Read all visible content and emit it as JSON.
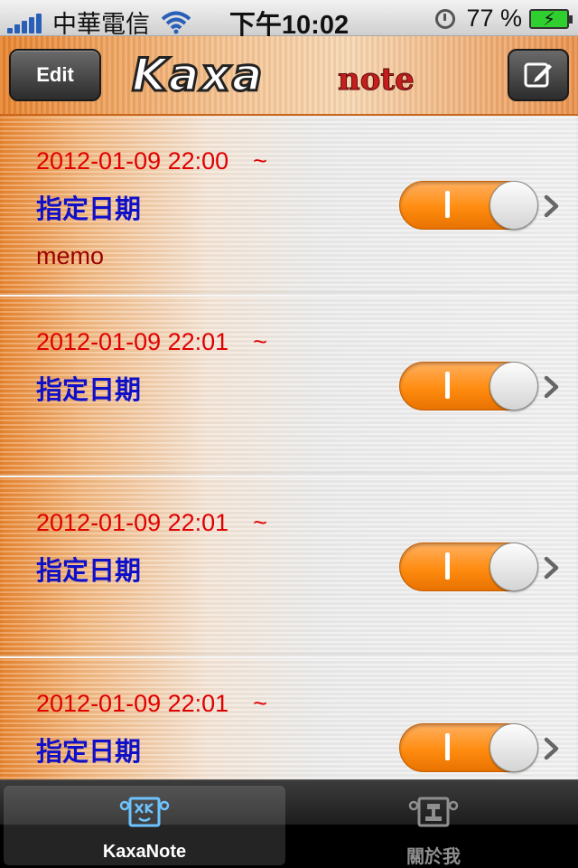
{
  "status_bar": {
    "carrier": "中華電信",
    "time": "下午10:02",
    "battery": "77 %",
    "icons": [
      "signal-icon",
      "wifi-icon",
      "clock-icon",
      "battery-charging-icon"
    ]
  },
  "nav": {
    "edit_label": "Edit",
    "logo_main": "Kaxa",
    "logo_sub": "note",
    "compose_icon": "compose-icon"
  },
  "list": {
    "items": [
      {
        "date": "2012-01-09 22:00　~",
        "type": "指定日期",
        "memo": "memo",
        "enabled": true
      },
      {
        "date": "2012-01-09 22:01　~",
        "type": "指定日期",
        "memo": "",
        "enabled": true
      },
      {
        "date": "2012-01-09 22:01　~",
        "type": "指定日期",
        "memo": "",
        "enabled": true
      },
      {
        "date": "2012-01-09 22:01　~",
        "type": "指定日期",
        "memo": "",
        "enabled": true
      }
    ]
  },
  "tabs": [
    {
      "label": "KaxaNote",
      "icon": "kaxanote-icon",
      "active": true
    },
    {
      "label": "關於我",
      "icon": "about-me-icon",
      "active": false
    }
  ],
  "colors": {
    "accent_orange": "#ff8c10",
    "date_red": "#e00000",
    "type_blue": "#1010c8",
    "memo_dark_red": "#9a0000"
  }
}
